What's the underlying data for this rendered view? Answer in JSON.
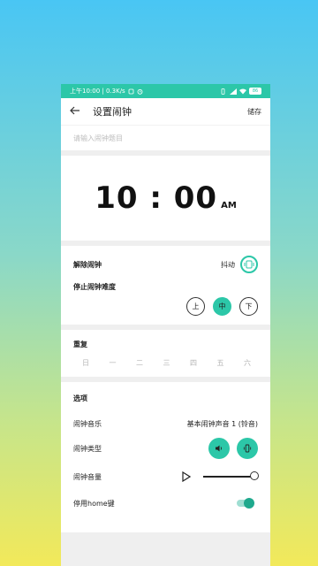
{
  "statusbar": {
    "time_speed": "上午10:00 | 0.3K/s",
    "battery": "86"
  },
  "header": {
    "title": "设置闹钟",
    "save_label": "储存"
  },
  "search": {
    "placeholder": "请输入闹钟题目"
  },
  "alarm": {
    "time": "10 : 00",
    "ampm": "AM"
  },
  "dismiss": {
    "label": "解除闹钟",
    "mode": "抖动"
  },
  "difficulty": {
    "label": "停止闹钟难度",
    "options": [
      "上",
      "中",
      "下"
    ],
    "selected": "中"
  },
  "repeat": {
    "label": "重复",
    "days": [
      "日",
      "一",
      "二",
      "三",
      "四",
      "五",
      "六"
    ]
  },
  "options": {
    "label": "选项",
    "music_label": "闹钟音乐",
    "music_value": "基本闹钟声音 1 (铃音)",
    "type_label": "闹钟类型",
    "volume_label": "闹钟音量",
    "volume_level": 1.0,
    "home_label": "停用home键",
    "home_enabled": true
  },
  "colors": {
    "accent": "#2cc7a8"
  },
  "icons": [
    "back-arrow-icon",
    "alarm-icon",
    "wifi-icon",
    "shake-icon",
    "speaker-icon",
    "vibrate-icon",
    "play-icon"
  ]
}
